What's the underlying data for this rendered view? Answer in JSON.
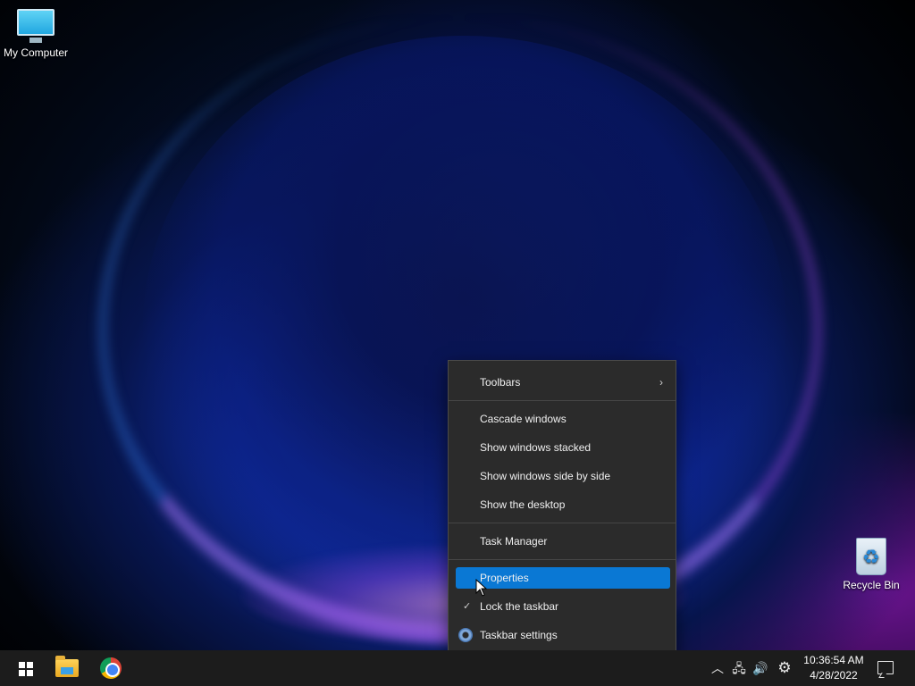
{
  "desktop": {
    "icons": [
      {
        "label": "My Computer",
        "icon": "monitor-icon"
      },
      {
        "label": "Recycle Bin",
        "icon": "recycle-bin-icon"
      }
    ]
  },
  "context_menu": {
    "items": {
      "toolbars": "Toolbars",
      "cascade": "Cascade windows",
      "stacked": "Show windows stacked",
      "side_by_side": "Show windows side by side",
      "show_desktop": "Show the desktop",
      "task_manager": "Task Manager",
      "properties": "Properties",
      "lock_taskbar": "Lock the taskbar",
      "taskbar_settings": "Taskbar settings"
    },
    "submenu_arrow": "›",
    "checkmark": "✓",
    "active_color": "#0a78d4"
  },
  "taskbar": {
    "tray": {
      "chevron": "︿",
      "network": "🖧",
      "volume": "🔊",
      "settings": "⚙"
    },
    "clock": {
      "time": "10:36:54 AM",
      "date": "4/28/2022"
    }
  }
}
